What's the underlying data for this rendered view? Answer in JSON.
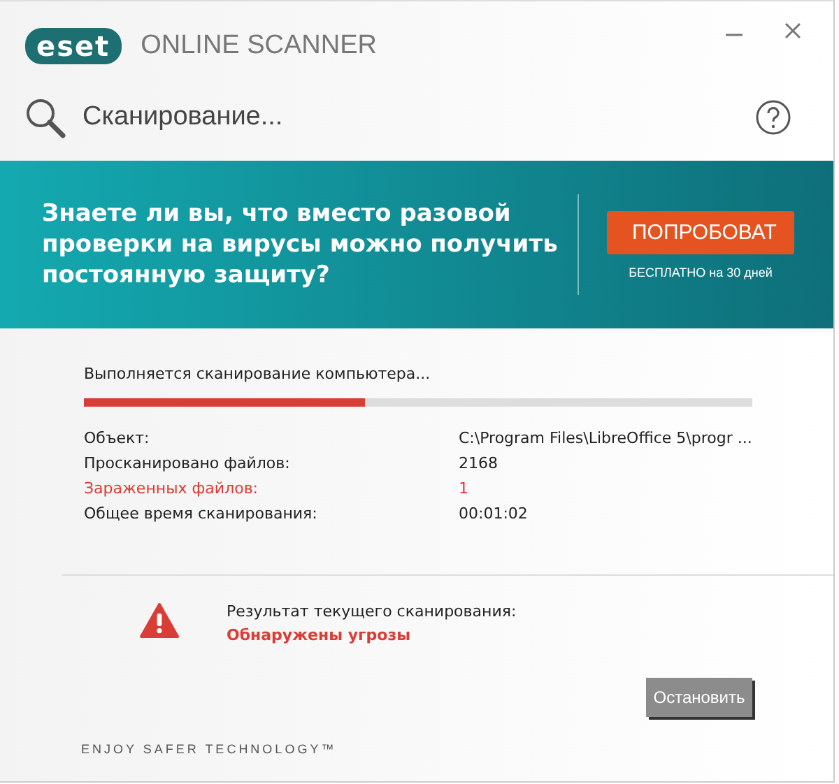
{
  "header": {
    "logo": "eset",
    "product": "ONLINE SCANNER"
  },
  "status": {
    "title": "Сканирование..."
  },
  "banner": {
    "text": "Знаете ли вы, что вместо разовой проверки на вирусы можно получить постоянную защиту?",
    "button": "ПОПРОБОВАТ",
    "note": "БЕСПЛАТНО на 30 дней"
  },
  "progress": {
    "label": "Выполняется сканирование компьютера...",
    "level": 0.42
  },
  "details": [
    {
      "label": "Объект:",
      "value": "C:\\Program Files\\LibreOffice 5\\progr ...",
      "kind": "normal"
    },
    {
      "label": "Просканировано файлов:",
      "value": "2168",
      "kind": "normal"
    },
    {
      "label": "Зараженных файлов:",
      "value": "1",
      "kind": "alert"
    },
    {
      "label": "Общее время сканирования:",
      "value": "00:01:02",
      "kind": "normal"
    }
  ],
  "result": {
    "label": "Результат текущего сканирования:",
    "value": "Обнаружены угрозы"
  },
  "stop_button": "Остановить",
  "footer": "ENJOY SAFER TECHNOLOGY™"
}
